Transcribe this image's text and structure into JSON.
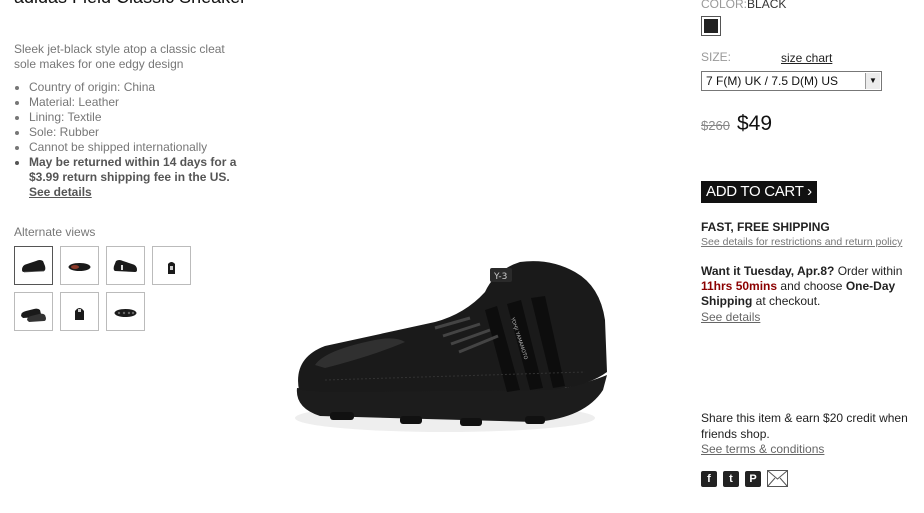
{
  "product": {
    "title": "adidas Field Classic Sneaker",
    "description": "Sleek jet-black style atop a classic cleat sole makes for one edgy design",
    "bullets": [
      "Country of origin: China",
      "Material: Leather",
      "Lining: Textile",
      "Sole: Rubber",
      "Cannot be shipped internationally"
    ],
    "return_policy": "May be returned within 14 days for a $3.99 return shipping fee in the US.",
    "return_link": "See details"
  },
  "alternate_views": {
    "label": "Alternate views",
    "thumbnails": [
      "side-view",
      "top-view",
      "side-view-left",
      "back-view",
      "pair-view",
      "front-view",
      "sole-view"
    ]
  },
  "color": {
    "label": "COLOR:",
    "value": "BLACK",
    "swatch": "#222222"
  },
  "size": {
    "label": "SIZE:",
    "chart_link": "size chart",
    "selected": "7 F(M) UK / 7.5 D(M) US"
  },
  "price": {
    "original": "$260",
    "sale": "$49"
  },
  "cart": {
    "button_label": "ADD TO CART"
  },
  "shipping": {
    "title": "FAST, FREE SHIPPING",
    "link": "See details for restrictions and return policy"
  },
  "delivery": {
    "want_it": "Want it Tuesday, Apr.8?",
    "order_within": "Order within",
    "countdown": "11hrs 50mins",
    "and_choose": "and choose",
    "one_day": "One-Day Shipping",
    "at_checkout": "at checkout.",
    "link": "See details"
  },
  "share": {
    "text": "Share this item & earn $20 credit when friends shop.",
    "terms_link": "See terms & conditions",
    "icons": [
      "facebook-icon",
      "twitter-icon",
      "pinterest-icon",
      "email-icon"
    ]
  }
}
